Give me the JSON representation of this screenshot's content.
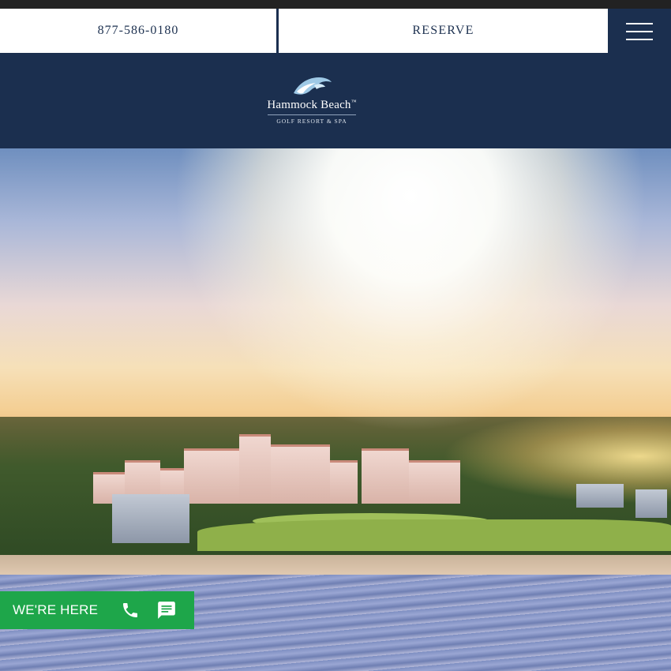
{
  "topbar": {
    "phone_label": "877-586-0180",
    "reserve_label": "RESERVE",
    "menu_icon": "hamburger-menu-icon"
  },
  "header": {
    "logo": {
      "icon": "wave-logo-icon",
      "name": "Hammock Beach",
      "trademark": "™",
      "subtitle": "GOLF RESORT & SPA"
    }
  },
  "hero": {
    "image": "aerial-resort-sunrise-photo"
  },
  "chat_widget": {
    "label": "WE'RE HERE",
    "phone_icon": "phone-icon",
    "message_icon": "chat-message-icon"
  },
  "colors": {
    "navy": "#1b2f4f",
    "white": "#ffffff",
    "text_navy": "#1d3150",
    "green": "#1ea64a"
  }
}
